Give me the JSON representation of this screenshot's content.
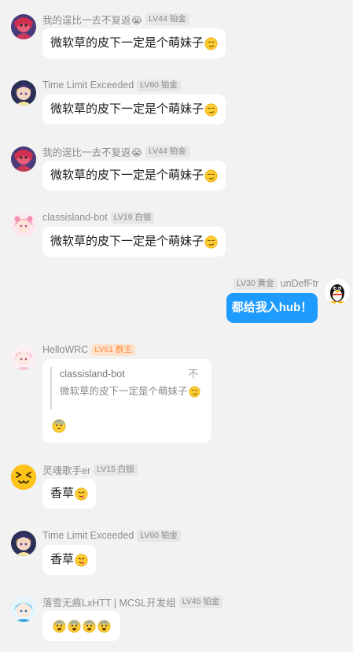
{
  "messages": [
    {
      "nick": "我的逞比一去不复返😭",
      "level": "LV44 铂金",
      "text": "微软草的皮下一定是个萌妹子",
      "emoji": "smirk"
    },
    {
      "nick": "Time Limit Exceeded",
      "level": "LV60 铂金",
      "text": "微软草的皮下一定是个萌妹子",
      "emoji": "smirk"
    },
    {
      "nick": "我的逞比一去不复返😭",
      "level": "LV44 铂金",
      "text": "微软草的皮下一定是个萌妹子",
      "emoji": "smirk"
    },
    {
      "nick": "classisland-bot",
      "level": "LV19 白银",
      "text": "微软草的皮下一定是个萌妹子",
      "emoji": "smirk"
    },
    {
      "nick": "unDefFtr",
      "level": "LV30 黄金",
      "text": "都给我入hub！",
      "mine": true
    },
    {
      "nick": "HelloWRC",
      "level": "LV61 群主",
      "owner": true,
      "quote": {
        "author": "classisland-bot",
        "extra": "不",
        "text": "微软草的皮下一定是个萌妹子"
      },
      "emoji": "cold-sweat"
    },
    {
      "nick": "灵魂歌手er",
      "level": "LV15 白银",
      "text": "香草",
      "emoji": "yum"
    },
    {
      "nick": "Time Limit Exceeded",
      "level": "LV60 铂金",
      "text": "香草",
      "emoji": "yum"
    },
    {
      "nick": "落雪无痕LxHTT | MCSL开发组",
      "level": "LV45 铂金",
      "text": "",
      "emoji_run": [
        "fearful",
        "fearful",
        "fearful",
        "fearful"
      ]
    }
  ],
  "colors": {
    "background": "#f2f2f2",
    "bubble": "#ffffff",
    "mine_bubble": "#1e9bff",
    "owner_badge_bg": "#ffe2cc",
    "owner_badge_fg": "#ff8a3d"
  }
}
